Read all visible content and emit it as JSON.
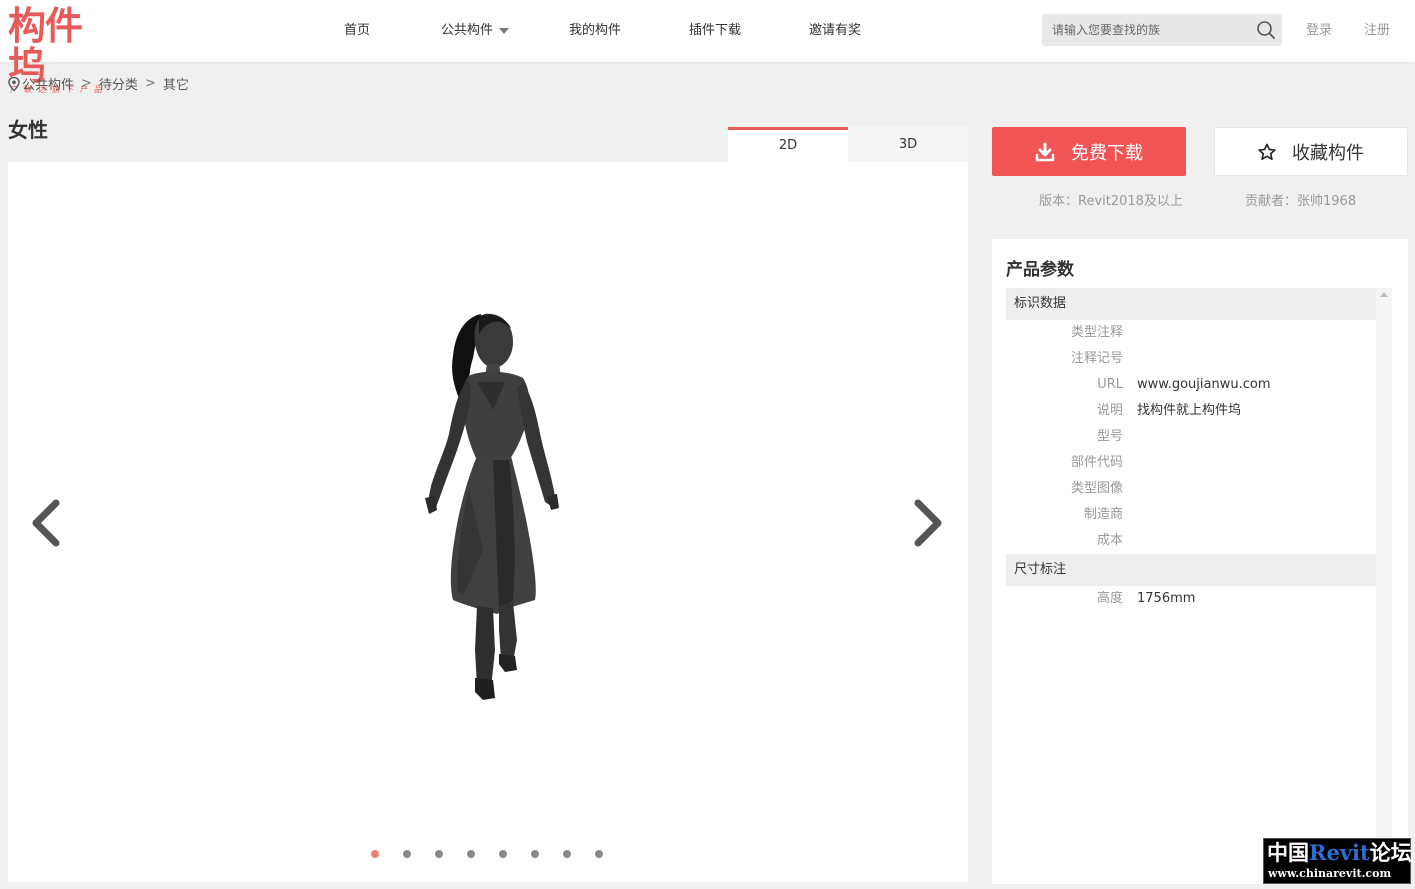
{
  "logo": {
    "main": "构件坞",
    "sub": "广联达旗下产品"
  },
  "nav": {
    "items": [
      {
        "label": "首页"
      },
      {
        "label": "公共构件"
      },
      {
        "label": "我的构件"
      },
      {
        "label": "插件下载"
      },
      {
        "label": "邀请有奖"
      }
    ]
  },
  "search": {
    "placeholder": "请输入您要查找的族"
  },
  "auth": {
    "login": "登录",
    "register": "注册"
  },
  "breadcrumb": {
    "items": [
      "公共构件",
      "待分类",
      "其它"
    ],
    "separator": ">"
  },
  "page": {
    "title": "女性"
  },
  "view_tabs": [
    {
      "label": "2D",
      "active": true
    },
    {
      "label": "3D",
      "active": false
    }
  ],
  "viewer": {
    "slide_count": 8,
    "active_slide": 1
  },
  "actions": {
    "download": "免费下载",
    "favorite": "收藏构件"
  },
  "meta": {
    "version": "版本：Revit2018及以上",
    "contributor": "贡献者：张帅1968"
  },
  "params": {
    "title": "产品参数",
    "groups": [
      {
        "name": "标识数据",
        "rows": [
          {
            "label": "类型注释",
            "value": ""
          },
          {
            "label": "注释记号",
            "value": ""
          },
          {
            "label": "URL",
            "value": "www.goujianwu.com"
          },
          {
            "label": "说明",
            "value": "找构件就上构件坞"
          },
          {
            "label": "型号",
            "value": ""
          },
          {
            "label": "部件代码",
            "value": ""
          },
          {
            "label": "类型图像",
            "value": ""
          },
          {
            "label": "制造商",
            "value": ""
          },
          {
            "label": "成本",
            "value": ""
          }
        ]
      },
      {
        "name": "尺寸标注",
        "rows": [
          {
            "label": "高度",
            "value": "1756mm"
          }
        ]
      }
    ]
  },
  "watermark": {
    "cn_prefix": "中国",
    "brand": "Revit",
    "cn_suffix": "论坛",
    "url": "www.chinarevit.com"
  },
  "colors": {
    "accent": "#f05454",
    "dot_active": "#e8807a"
  }
}
